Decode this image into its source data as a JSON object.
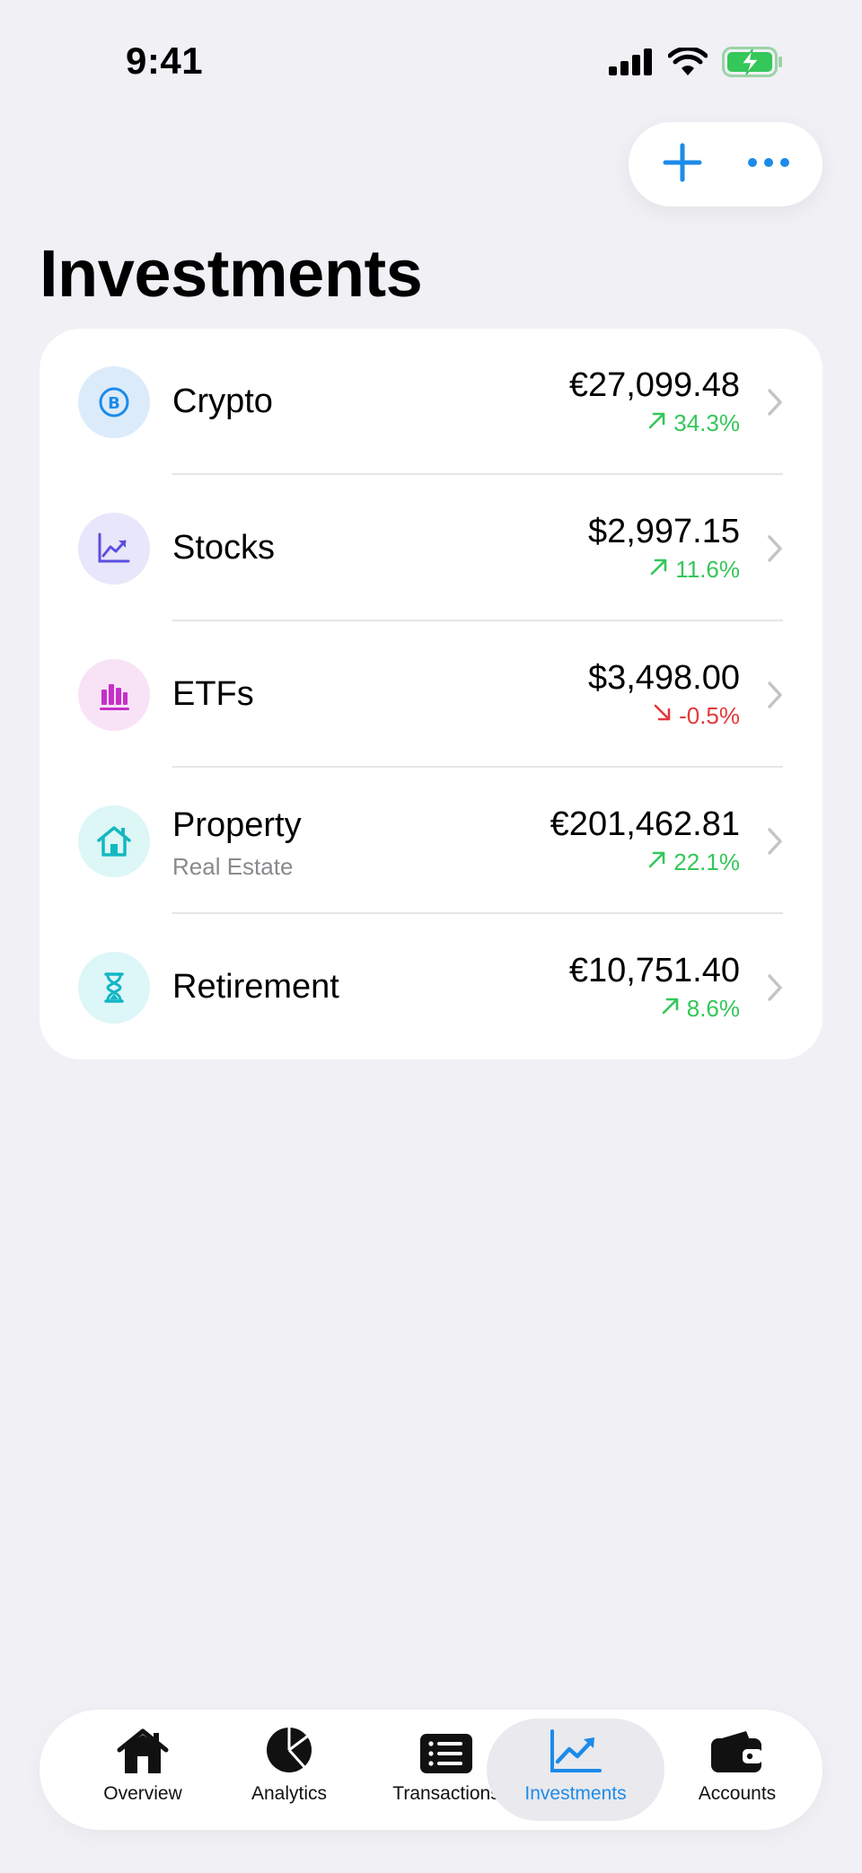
{
  "status_bar": {
    "time": "9:41"
  },
  "header": {
    "title": "Investments",
    "add_icon": "plus-icon",
    "more_icon": "ellipsis-icon"
  },
  "investments": [
    {
      "name": "Crypto",
      "subtitle": "",
      "amount": "€27,099.48",
      "change": "34.3%",
      "direction": "up",
      "icon": "bitcoin-icon",
      "icon_bg": "#DCEBFA",
      "icon_color": "#1C8BE9"
    },
    {
      "name": "Stocks",
      "subtitle": "",
      "amount": "$2,997.15",
      "change": "11.6%",
      "direction": "up",
      "icon": "chart-line-icon",
      "icon_bg": "#E8E6FA",
      "icon_color": "#5B4FE0"
    },
    {
      "name": "ETFs",
      "subtitle": "",
      "amount": "$3,498.00",
      "change": "-0.5%",
      "direction": "down",
      "icon": "bar-chart-icon",
      "icon_bg": "#F8E3F6",
      "icon_color": "#C530C8"
    },
    {
      "name": "Property",
      "subtitle": "Real Estate",
      "amount": "€201,462.81",
      "change": "22.1%",
      "direction": "up",
      "icon": "house-icon",
      "icon_bg": "#DDF6F6",
      "icon_color": "#14B8C0"
    },
    {
      "name": "Retirement",
      "subtitle": "",
      "amount": "€10,751.40",
      "change": "8.6%",
      "direction": "up",
      "icon": "hourglass-icon",
      "icon_bg": "#DDF6F8",
      "icon_color": "#12B6C6"
    }
  ],
  "tabs": [
    {
      "label": "Overview",
      "icon": "house-fill-icon",
      "active": false
    },
    {
      "label": "Analytics",
      "icon": "pie-chart-icon",
      "active": false
    },
    {
      "label": "Transactions",
      "icon": "list-icon",
      "active": false
    },
    {
      "label": "Investments",
      "icon": "chart-line-icon",
      "active": true
    },
    {
      "label": "Accounts",
      "icon": "wallet-icon",
      "active": false
    }
  ],
  "colors": {
    "accent": "#1C8BE9",
    "positive": "#34C759",
    "negative": "#E5383B",
    "background": "#F0F0F5"
  }
}
